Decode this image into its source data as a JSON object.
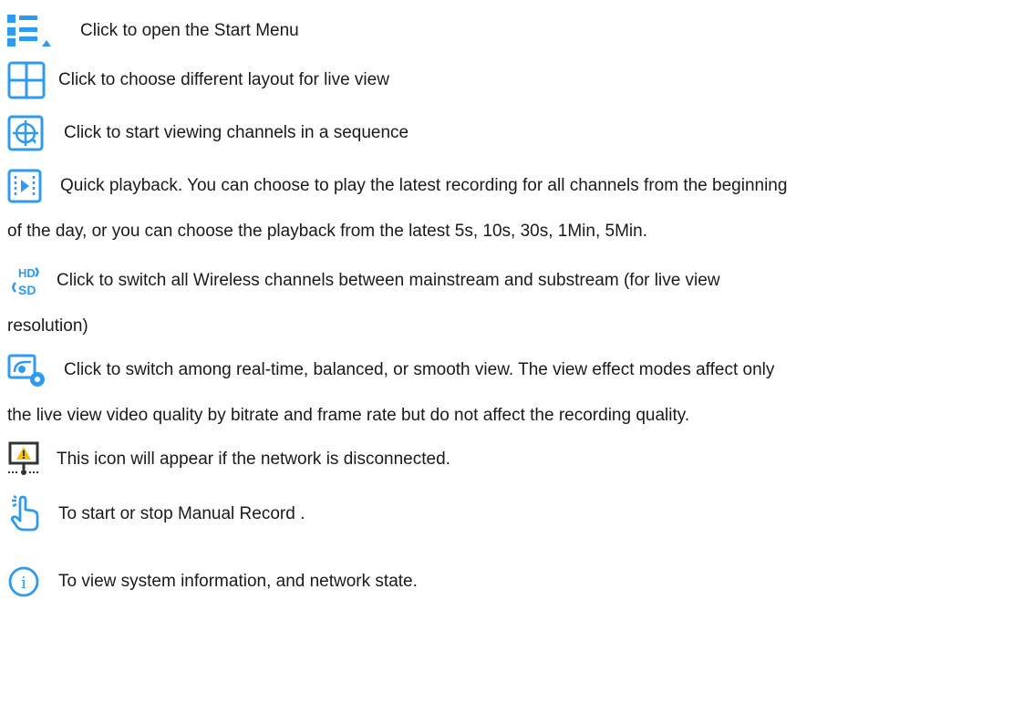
{
  "accent_color": "#2e9bf0",
  "warning_color": "#f5c000",
  "items": [
    {
      "icon": "start-menu-icon",
      "text": "Click to open the Start Menu"
    },
    {
      "icon": "layout-grid-icon",
      "text": "Click to choose different layout for live view"
    },
    {
      "icon": "sequence-view-icon",
      "text": "Click to start viewing channels in a sequence"
    },
    {
      "icon": "quick-playback-icon",
      "text": "Quick playback. You can choose to play the latest recording for all channels from the beginning",
      "text2": "of the day, or you can choose the playback from the latest 5s, 10s, 30s, 1Min, 5Min."
    },
    {
      "icon": "hd-sd-switch-icon",
      "icon_text_top": "HD",
      "icon_text_bottom": "SD",
      "text": "Click to switch all Wireless channels between mainstream and substream (for live view",
      "text2": "resolution)"
    },
    {
      "icon": "view-effect-icon",
      "text": "Click to switch among real-time, balanced, or smooth view. The view effect modes affect only",
      "text2": "the live view video quality by bitrate and frame rate but do not affect the recording quality."
    },
    {
      "icon": "network-disconnected-icon",
      "text": "This icon will appear if the network is disconnected."
    },
    {
      "icon": "manual-record-hand-icon",
      "text": "To start or stop Manual Record ."
    },
    {
      "icon": "info-icon",
      "icon_text": "i",
      "text": "To view system information, and network state."
    }
  ]
}
